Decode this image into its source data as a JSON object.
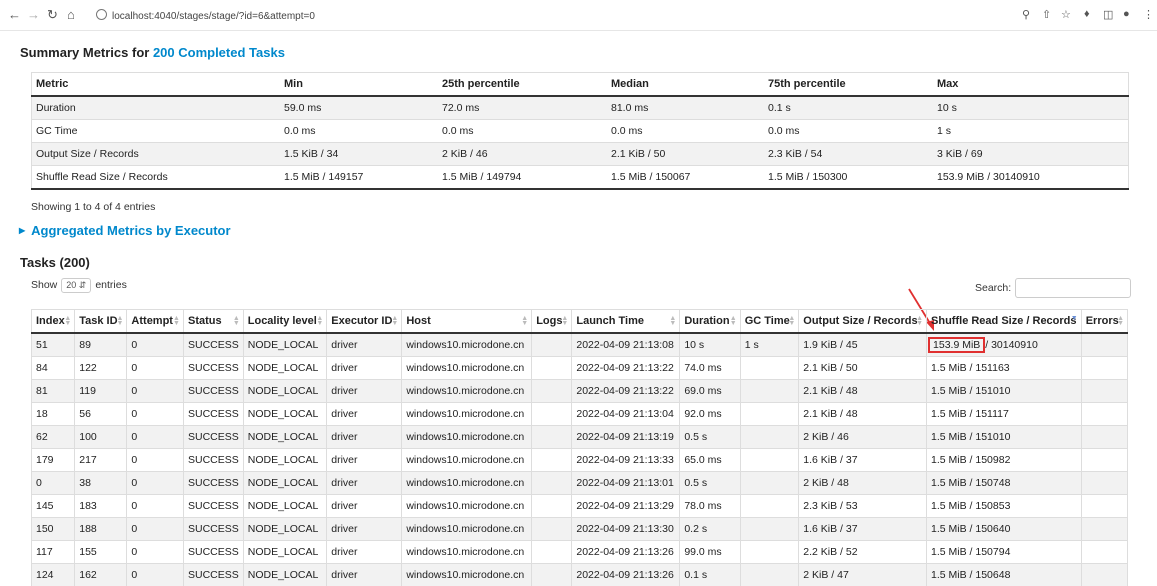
{
  "browser": {
    "url": "localhost:4040/stages/stage/?id=6&attempt=0"
  },
  "summary": {
    "title_prefix": "Summary Metrics for ",
    "title_link": "200 Completed Tasks",
    "headers": [
      "Metric",
      "Min",
      "25th percentile",
      "Median",
      "75th percentile",
      "Max"
    ],
    "rows": [
      [
        "Duration",
        "59.0 ms",
        "72.0 ms",
        "81.0 ms",
        "0.1 s",
        "10 s"
      ],
      [
        "GC Time",
        "0.0 ms",
        "0.0 ms",
        "0.0 ms",
        "0.0 ms",
        "1 s"
      ],
      [
        "Output Size / Records",
        "1.5 KiB / 34",
        "2 KiB / 46",
        "2.1 KiB / 50",
        "2.3 KiB / 54",
        "3 KiB / 69"
      ],
      [
        "Shuffle Read Size / Records",
        "1.5 MiB / 149157",
        "1.5 MiB / 149794",
        "1.5 MiB / 150067",
        "1.5 MiB / 150300",
        "153.9 MiB / 30140910"
      ]
    ],
    "showing": "Showing 1 to 4 of 4 entries"
  },
  "aggregated_link": "Aggregated Metrics by Executor",
  "tasks": {
    "title": "Tasks (200)",
    "show_label": "Show",
    "page_size": "20",
    "entries_label": "entries",
    "search_label": "Search:",
    "headers": [
      "Index",
      "Task ID",
      "Attempt",
      "Status",
      "Locality level",
      "Executor ID",
      "Host",
      "Logs",
      "Launch Time",
      "Duration",
      "GC Time",
      "Output Size / Records",
      "Shuffle Read Size / Records",
      "Errors"
    ],
    "first_row_shuffle_highlight": "153.9 MiB",
    "first_row_shuffle_rest": " / 30140910",
    "rows": [
      [
        "51",
        "89",
        "0",
        "SUCCESS",
        "NODE_LOCAL",
        "driver",
        "windows10.microdone.cn",
        "",
        "2022-04-09 21:13:08",
        "10 s",
        "1 s",
        "1.9 KiB / 45",
        "",
        ""
      ],
      [
        "84",
        "122",
        "0",
        "SUCCESS",
        "NODE_LOCAL",
        "driver",
        "windows10.microdone.cn",
        "",
        "2022-04-09 21:13:22",
        "74.0 ms",
        "",
        "2.1 KiB / 50",
        "1.5 MiB / 151163",
        ""
      ],
      [
        "81",
        "119",
        "0",
        "SUCCESS",
        "NODE_LOCAL",
        "driver",
        "windows10.microdone.cn",
        "",
        "2022-04-09 21:13:22",
        "69.0 ms",
        "",
        "2.1 KiB / 48",
        "1.5 MiB / 151010",
        ""
      ],
      [
        "18",
        "56",
        "0",
        "SUCCESS",
        "NODE_LOCAL",
        "driver",
        "windows10.microdone.cn",
        "",
        "2022-04-09 21:13:04",
        "92.0 ms",
        "",
        "2.1 KiB / 48",
        "1.5 MiB / 151117",
        ""
      ],
      [
        "62",
        "100",
        "0",
        "SUCCESS",
        "NODE_LOCAL",
        "driver",
        "windows10.microdone.cn",
        "",
        "2022-04-09 21:13:19",
        "0.5 s",
        "",
        "2 KiB / 46",
        "1.5 MiB / 151010",
        ""
      ],
      [
        "179",
        "217",
        "0",
        "SUCCESS",
        "NODE_LOCAL",
        "driver",
        "windows10.microdone.cn",
        "",
        "2022-04-09 21:13:33",
        "65.0 ms",
        "",
        "1.6 KiB / 37",
        "1.5 MiB / 150982",
        ""
      ],
      [
        "0",
        "38",
        "0",
        "SUCCESS",
        "NODE_LOCAL",
        "driver",
        "windows10.microdone.cn",
        "",
        "2022-04-09 21:13:01",
        "0.5 s",
        "",
        "2 KiB / 48",
        "1.5 MiB / 150748",
        ""
      ],
      [
        "145",
        "183",
        "0",
        "SUCCESS",
        "NODE_LOCAL",
        "driver",
        "windows10.microdone.cn",
        "",
        "2022-04-09 21:13:29",
        "78.0 ms",
        "",
        "2.3 KiB / 53",
        "1.5 MiB / 150853",
        ""
      ],
      [
        "150",
        "188",
        "0",
        "SUCCESS",
        "NODE_LOCAL",
        "driver",
        "windows10.microdone.cn",
        "",
        "2022-04-09 21:13:30",
        "0.2 s",
        "",
        "1.6 KiB / 37",
        "1.5 MiB / 150640",
        ""
      ],
      [
        "117",
        "155",
        "0",
        "SUCCESS",
        "NODE_LOCAL",
        "driver",
        "windows10.microdone.cn",
        "",
        "2022-04-09 21:13:26",
        "99.0 ms",
        "",
        "2.2 KiB / 52",
        "1.5 MiB / 150794",
        ""
      ],
      [
        "124",
        "162",
        "0",
        "SUCCESS",
        "NODE_LOCAL",
        "driver",
        "windows10.microdone.cn",
        "",
        "2022-04-09 21:13:26",
        "0.1 s",
        "",
        "2 KiB / 47",
        "1.5 MiB / 150648",
        ""
      ]
    ]
  },
  "colors": {
    "link": "#0088cc",
    "highlight": "#e03030",
    "stripe": "#f2f2f2"
  }
}
